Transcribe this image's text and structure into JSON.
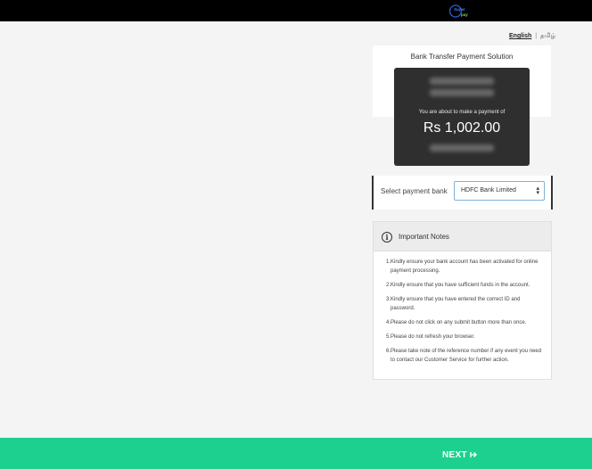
{
  "header": {
    "logo_alt": "Super pay"
  },
  "language": {
    "active": "English",
    "separator": "|",
    "alternate": "தமிழ்"
  },
  "payment": {
    "title": "Bank Transfer Payment Solution",
    "prompt": "You are about to make a payment of",
    "amount": "Rs 1,002.00"
  },
  "bank": {
    "label": "Select payment bank",
    "selected": "HDFC Bank Limited"
  },
  "notes": {
    "title": "Important Notes",
    "items": [
      "Kindly ensure your bank account has been activated for online payment processing.",
      "Kindly ensure that you have sufficient funds in the account.",
      "Kindly ensure that you have entered the correct ID and password.",
      "Please do not click on any submit button more than once.",
      "Please do not refresh your browser.",
      "Please take note of the reference number if any event you need to contact our Customer Service for further action."
    ]
  },
  "footer": {
    "next_label": "NEXT"
  },
  "colors": {
    "top_bar": "#000000",
    "footer_bar": "#1dd08f",
    "payment_box": "#2f2f2f",
    "select_border": "#7fb2d8"
  }
}
